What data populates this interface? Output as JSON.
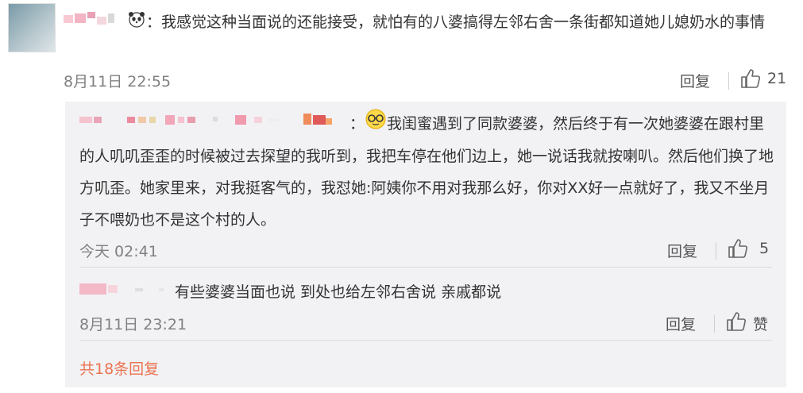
{
  "comment": {
    "sep": "：",
    "text": "我感觉这种当面说的还能接受，就怕有的八婆搞得左邻右舍一条街都知道她儿媳奶水的事情",
    "time": "8月11日 22:55",
    "reply_label": "回复",
    "likes": "21"
  },
  "replies": [
    {
      "sep": "：",
      "text": "我闺蜜遇到了同款婆婆，然后终于有一次她婆婆在跟村里的人叽叽歪歪的时候被过去探望的我听到，我把车停在他们边上，她一说话我就按喇叭。然后他们换了地方叽歪。她家里来，对我挺客气的，我怼她:阿姨你不用对我那么好，你对XX好一点就好了，我又不坐月子不喂奶也不是这个村的人。",
      "time": "今天 02:41",
      "reply_label": "回复",
      "likes": "5"
    },
    {
      "sep": "",
      "text": "有些婆婆当面也说   到处也给左邻右舍说   亲戚都说",
      "time": "8月11日 23:21",
      "reply_label": "回复",
      "likes": "赞"
    }
  ],
  "more_replies": "共18条回复",
  "colors": {
    "accent": "#eb7350",
    "reply_bg": "#f2f2f5"
  },
  "icons": [
    "thumbs-up-icon",
    "sunglasses-emoji-icon",
    "panda-emoji-icon"
  ]
}
